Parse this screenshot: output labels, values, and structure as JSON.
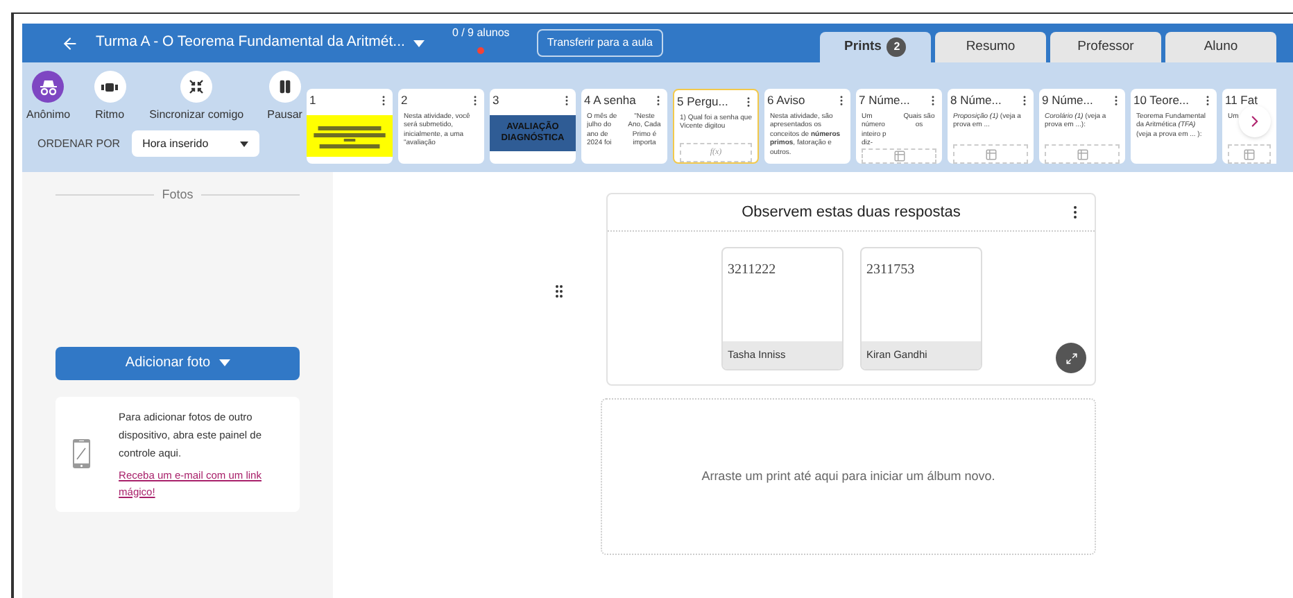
{
  "header": {
    "title": "Turma A - O Teorema Fundamental da Aritmét...",
    "students": "0 / 9 alunos",
    "live": true,
    "transfer_button": "Transferir para a aula"
  },
  "tabs": [
    {
      "label": "Prints",
      "badge": "2",
      "selected": true
    },
    {
      "label": "Resumo",
      "selected": false
    },
    {
      "label": "Professor",
      "selected": false
    },
    {
      "label": "Aluno",
      "selected": false
    }
  ],
  "toolbar": {
    "buttons": [
      {
        "label": "Anônimo",
        "kind": "anonymous",
        "on": true
      },
      {
        "label": "Ritmo",
        "kind": "pace",
        "on": false
      },
      {
        "label": "Sincronizar comigo",
        "kind": "sync",
        "on": false
      },
      {
        "label": "Pausar",
        "kind": "pause",
        "on": false
      }
    ],
    "sort_label": "ORDENAR POR",
    "sort_value": "Hora inserido"
  },
  "slides": [
    {
      "title": "1",
      "selected": false,
      "kind": "picture"
    },
    {
      "title": "2",
      "selected": false,
      "kind": "text",
      "text": "Nesta atividade, você será submetido, inicialmente, a uma \"avaliação"
    },
    {
      "title": "3",
      "selected": false,
      "kind": "banner",
      "text": "AVALIAÇÃO DIAGNÓSTICA"
    },
    {
      "title": "4 A senha",
      "selected": false,
      "kind": "columns",
      "columns": [
        "O mês de julho do ano de 2024 foi",
        "\"Neste Ano, Cada Primo é importa"
      ]
    },
    {
      "title": "5 Pergu...",
      "selected": true,
      "kind": "formula",
      "text": "1) Qual foi a senha que Vicente digitou",
      "formula": "f(x)"
    },
    {
      "title": "6 Aviso",
      "selected": false,
      "kind": "text",
      "text": "Nesta atividade, são apresentados os conceitos de **números primos**, fatoração e outros."
    },
    {
      "title": "7 Núme...",
      "selected": false,
      "kind": "columns_table",
      "columns": [
        "Um número inteiro p diz-",
        "Quais são os"
      ]
    },
    {
      "title": "8 Núme...",
      "selected": false,
      "kind": "table",
      "text": "*Proposição (1)* (veja a prova em ..."
    },
    {
      "title": "9 Núme...",
      "selected": false,
      "kind": "table",
      "text": "*Corolário (1)* (veja a prova em ...):"
    },
    {
      "title": "10 Teore...",
      "selected": false,
      "kind": "text",
      "text": "Teorema Fundamental da Aritmética *(TFA)* (veja a prova em ... ):"
    },
    {
      "title": "11 Fat",
      "selected": false,
      "clipped": true,
      "kind": "table",
      "text": "Um"
    }
  ],
  "sidebar": {
    "section": "Fotos",
    "add_button": "Adicionar foto",
    "info": "Para adicionar fotos de outro dispositivo, abra este painel de controle aqui.",
    "link": "Receba um e-mail com um link mágico!"
  },
  "album": {
    "title": "Observem estas duas respostas",
    "prints": [
      {
        "answer": "3211222",
        "student": "Tasha Inniss"
      },
      {
        "answer": "2311753",
        "student": "Kiran Gandhi"
      }
    ]
  },
  "drop_zone": "Arraste um print até aqui para iniciar um álbum novo."
}
